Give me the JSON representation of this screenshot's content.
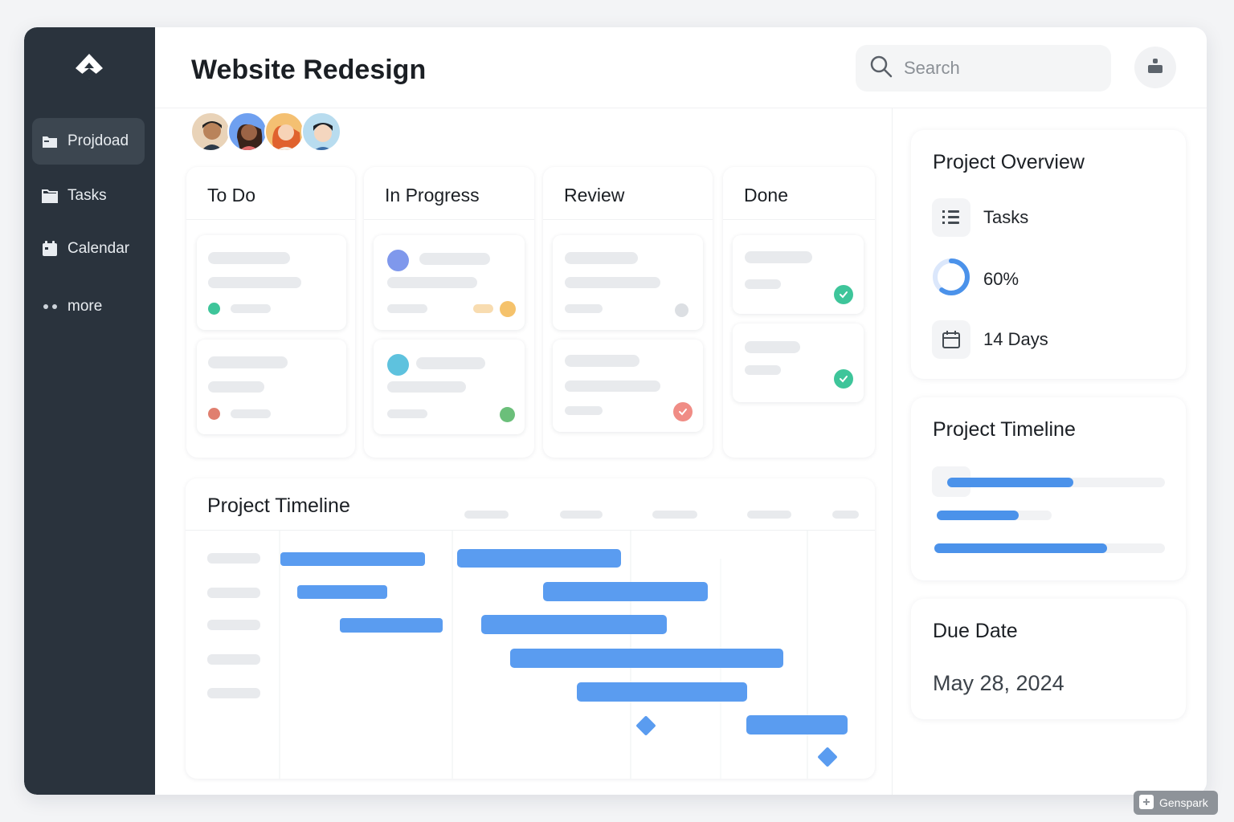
{
  "page": {
    "title": "Website Redesign"
  },
  "sidebar": {
    "logo_icon": "app-logo",
    "items": [
      {
        "label": "Projdoad",
        "icon": "folder-icon",
        "active": true
      },
      {
        "label": "Tasks",
        "icon": "folder-icon",
        "active": false
      },
      {
        "label": "Calendar",
        "icon": "calendar-icon",
        "active": false
      },
      {
        "label": "more",
        "icon": "more-dots-icon",
        "active": false
      }
    ]
  },
  "header": {
    "search": {
      "placeholder": "Search",
      "value": ""
    },
    "user_icon": "user-icon"
  },
  "team": {
    "avatars": [
      "avatar-1",
      "avatar-2",
      "avatar-3",
      "avatar-4"
    ]
  },
  "board": {
    "columns": [
      {
        "title": "To Do",
        "cards": [
          {
            "status_color": "#3ec59a"
          },
          {
            "status_color": "#e07f6f"
          }
        ]
      },
      {
        "title": "In Progress",
        "cards": [
          {
            "status_color": "#f5c26b"
          },
          {
            "status_color": "#6bbf7a"
          }
        ]
      },
      {
        "title": "Review",
        "cards": [
          {
            "status_color": "#dcdfe3"
          },
          {
            "status_color": "#f08c85"
          }
        ]
      },
      {
        "title": "Done",
        "cards": [
          {
            "status_color": "#3ec59a"
          },
          {
            "status_color": "#3ec59a"
          }
        ]
      }
    ]
  },
  "gantt": {
    "title": "Project Timeline",
    "bar_color": "#5a9cf0"
  },
  "overview": {
    "title": "Project Overview",
    "tasks_label": "Tasks",
    "progress_label": "60%",
    "progress_value": 0.6,
    "days_label": "14 Days"
  },
  "timeline_panel": {
    "title": "Project Timeline",
    "progress": [
      0.58,
      0.71,
      0.75
    ]
  },
  "due_date": {
    "title": "Due Date",
    "value": "May 28, 2024"
  },
  "watermark": {
    "label": "Genspark"
  },
  "colors": {
    "sidebar_bg": "#2a333d",
    "accent_blue": "#5a9cf0",
    "success_green": "#3ec59a"
  }
}
